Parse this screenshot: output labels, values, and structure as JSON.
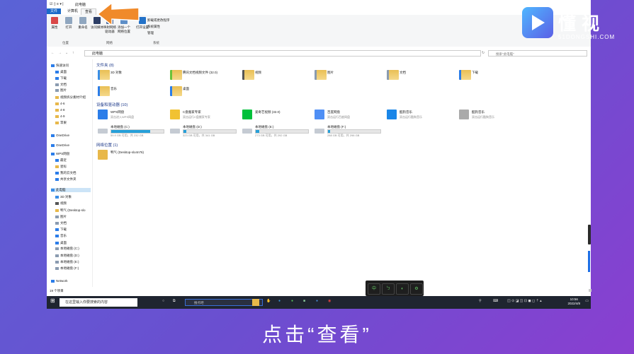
{
  "window": {
    "title": "此电脑",
    "quick_icons": "☑ ▯ ≡ ▾ |"
  },
  "tabs": [
    {
      "label": "文件",
      "kind": "file"
    },
    {
      "label": "计算机",
      "kind": "normal"
    },
    {
      "label": "查看",
      "kind": "active"
    }
  ],
  "ribbon": {
    "buttons": [
      {
        "label": "属性",
        "color": "#d94848"
      },
      {
        "label": "打开",
        "color": "#8fa6bf"
      },
      {
        "label": "重命名",
        "color": "#8fa6bf"
      },
      {
        "label": "访问媒体",
        "color": "#2d3e66"
      },
      {
        "label": "映射网络驱动器",
        "color": "#4c6c9e"
      },
      {
        "label": "添加一个网络位置",
        "color": "#5d8ec7"
      },
      {
        "label": "打开设置",
        "color": "#2372c8"
      }
    ],
    "links": [
      "卸载或更改程序",
      "系统属性",
      "管理"
    ],
    "groups": [
      "位置",
      "网络",
      "系统"
    ]
  },
  "address": {
    "path": "此电脑",
    "search_placeholder": "搜索\"此电脑\""
  },
  "nav": [
    {
      "label": "快速访问",
      "color": "#2b7de9"
    },
    {
      "label": "桌面",
      "color": "#2b7de9"
    },
    {
      "label": "下载",
      "color": "#2b7de9"
    },
    {
      "label": "文档",
      "color": "#8a9bb0"
    },
    {
      "label": "图片",
      "color": "#8a9bb0"
    },
    {
      "label": "视频拆分素材介绍",
      "color": "#e8b84a"
    },
    {
      "label": "4-6",
      "color": "#e8b84a"
    },
    {
      "label": "4-8",
      "color": "#e8b84a"
    },
    {
      "label": "4-9",
      "color": "#e8b84a"
    },
    {
      "label": "苹果",
      "color": "#e8b84a"
    },
    {
      "label": "OneDrive",
      "color": "#2b7de9"
    },
    {
      "label": "OneDrive",
      "color": "#2b7de9"
    },
    {
      "label": "WPS网盘",
      "color": "#2b7de9"
    },
    {
      "label": "最近",
      "color": "#2b7de9"
    },
    {
      "label": "星标",
      "color": "#e8b84a"
    },
    {
      "label": "我的云文档",
      "color": "#2b7de9"
    },
    {
      "label": "共享文件夹",
      "color": "#2b7de9"
    },
    {
      "label": "此电脑",
      "color": "#3a8ee6"
    },
    {
      "label": "3D 对象",
      "color": "#3a8ee6"
    },
    {
      "label": "视频",
      "color": "#555"
    },
    {
      "label": "鸭气 (Desktop-slo",
      "color": "#e8b84a"
    },
    {
      "label": "图片",
      "color": "#8a9bb0"
    },
    {
      "label": "文档",
      "color": "#8a9bb0"
    },
    {
      "label": "下载",
      "color": "#2b7de9"
    },
    {
      "label": "音乐",
      "color": "#2b7de9"
    },
    {
      "label": "桌面",
      "color": "#2b7de9"
    },
    {
      "label": "本地磁盘 (C:)",
      "color": "#8a9bb0"
    },
    {
      "label": "本地磁盘 (D:)",
      "color": "#8a9bb0"
    },
    {
      "label": "本地磁盘 (E:)",
      "color": "#8a9bb0"
    },
    {
      "label": "本地磁盘 (F:)",
      "color": "#8a9bb0"
    },
    {
      "label": "Network",
      "color": "#2b7de9"
    }
  ],
  "folders_header": "文件夹 (8)",
  "folders": [
    {
      "name": "3D 对象",
      "color": "#3a8ee6"
    },
    {
      "name": "腾讯文档视频文件 (32.0)",
      "color": "#6ac23a"
    },
    {
      "name": "视频",
      "color": "#555"
    },
    {
      "name": "图片",
      "color": "#8a9bb0"
    },
    {
      "name": "文档",
      "color": "#8a9bb0"
    },
    {
      "name": "下载",
      "color": "#2b7de9"
    },
    {
      "name": "音乐",
      "color": "#2b7de9"
    },
    {
      "name": "桌面",
      "color": "#2b7de9"
    }
  ],
  "devices_header": "设备和驱动器 (10)",
  "apps": [
    {
      "name": "WPS网盘",
      "sub": "双击进入WPS网盘",
      "color": "#2b7de9"
    },
    {
      "name": "C盘搬家专家",
      "sub": "双击运行C盘搬家专家",
      "color": "#f1c232"
    },
    {
      "name": "爱奇艺视频 (32.0)",
      "sub": "",
      "color": "#00c03a"
    },
    {
      "name": "百度网盘",
      "sub": "双击运行百度网盘",
      "color": "#4f8ff5"
    },
    {
      "name": "酷狗音乐",
      "sub": "双击运行酷狗音乐",
      "color": "#1a86e8"
    },
    {
      "name": "酷狗音乐",
      "sub": "双击运行酷狗音乐",
      "color": "#aaaaaa"
    }
  ],
  "drives": [
    {
      "name": "本地磁盘 (C:)",
      "cap": "59.9 GB 可用，共 232 GB",
      "used": 0.74
    },
    {
      "name": "本地磁盘 (D:)",
      "cap": "323 GB 可用，共 341 GB",
      "used": 0.05
    },
    {
      "name": "本地磁盘 (E:)",
      "cap": "273 GB 可用，共 292 GB",
      "used": 0.07
    },
    {
      "name": "本地磁盘 (F:)",
      "cap": "288 GB 可用，共 298 GB",
      "used": 0.04
    }
  ],
  "network_header": "网络位置 (1)",
  "network": [
    {
      "name": "鸭气 (Desktop-slo4n76)",
      "color": "#e8b84a"
    }
  ],
  "status": "19 个项目",
  "taskbar": {
    "search_text": "在这里输入你要搜索的内容",
    "box_text": "搜点吧",
    "time": "10:56",
    "date": "2022/4/8"
  },
  "ime": [
    "中",
    "ㄅ",
    "◐",
    "⚙"
  ],
  "logo": {
    "text": "懂视",
    "sub": "51DONGSHI.COM"
  },
  "caption": "点击“查看”"
}
